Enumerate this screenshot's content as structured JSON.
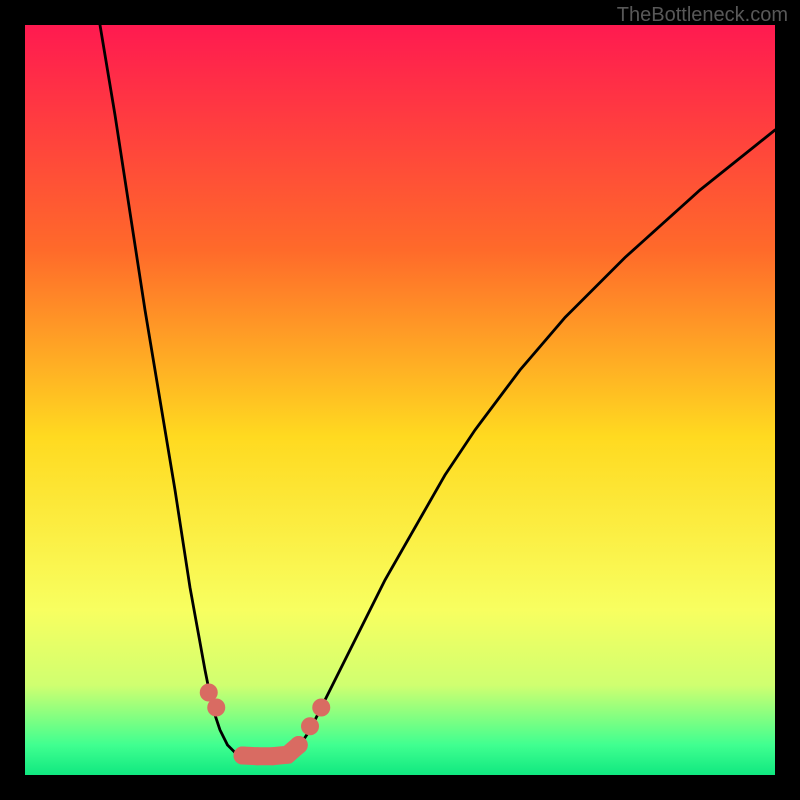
{
  "watermark": "TheBottleneck.com",
  "chart_data": {
    "type": "line",
    "title": "",
    "xlabel": "",
    "ylabel": "",
    "xlim": [
      0,
      100
    ],
    "ylim": [
      0,
      100
    ],
    "series": [
      {
        "name": "left-curve",
        "x": [
          10,
          12,
          14,
          16,
          18,
          20,
          22,
          24,
          25,
          26,
          27,
          28
        ],
        "values": [
          100,
          88,
          75,
          62,
          50,
          38,
          25,
          14,
          9,
          6,
          4,
          3
        ]
      },
      {
        "name": "right-curve",
        "x": [
          36,
          38,
          40,
          44,
          48,
          52,
          56,
          60,
          66,
          72,
          80,
          90,
          100
        ],
        "values": [
          3,
          6,
          10,
          18,
          26,
          33,
          40,
          46,
          54,
          61,
          69,
          78,
          86
        ]
      },
      {
        "name": "bottom-flat",
        "x": [
          28,
          30,
          32,
          34,
          36
        ],
        "values": [
          3,
          2.5,
          2.4,
          2.5,
          3
        ]
      }
    ],
    "highlight_markers": {
      "name": "thick-markers",
      "color": "#d96b62",
      "x": [
        24.5,
        25.5,
        29,
        31,
        33,
        35,
        36.5,
        38,
        39.5
      ],
      "values": [
        11,
        9,
        2.6,
        2.5,
        2.5,
        2.7,
        4,
        6.5,
        9
      ]
    },
    "background": {
      "type": "vertical-gradient",
      "stops": [
        {
          "offset": 0,
          "color": "#ff1a50"
        },
        {
          "offset": 30,
          "color": "#ff6a2a"
        },
        {
          "offset": 55,
          "color": "#ffda20"
        },
        {
          "offset": 78,
          "color": "#f8ff60"
        },
        {
          "offset": 88,
          "color": "#d0ff70"
        },
        {
          "offset": 96,
          "color": "#40ff90"
        },
        {
          "offset": 100,
          "color": "#10e880"
        }
      ]
    },
    "frame_color": "#000000",
    "frame_thickness_px": 25
  }
}
